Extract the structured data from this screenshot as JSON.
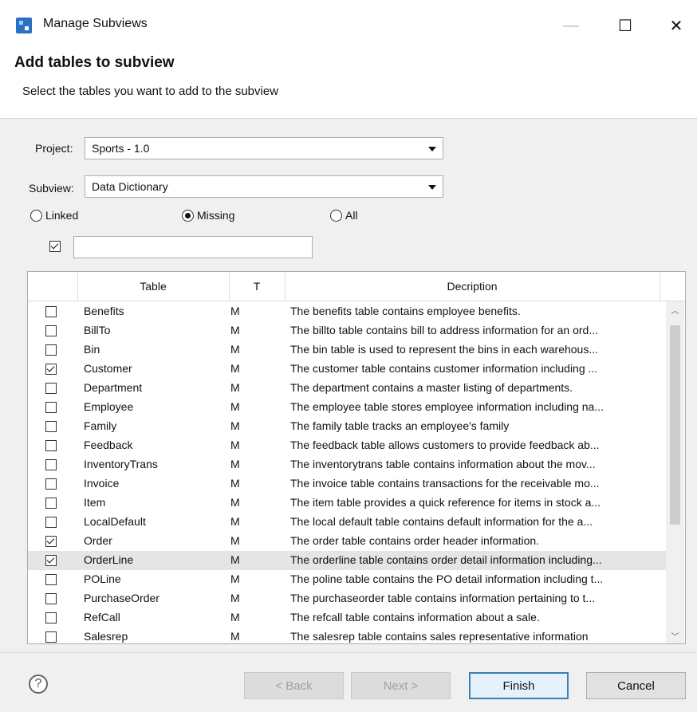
{
  "window": {
    "title": "Manage Subviews"
  },
  "header": {
    "title": "Add tables to subview",
    "subtitle": "Select the tables you want to add to the subview"
  },
  "form": {
    "project_label": "Project:",
    "project_value": "Sports - 1.0",
    "subview_label": "Subview:",
    "subview_value": "Data Dictionary",
    "radios": [
      {
        "label": "Linked",
        "selected": false
      },
      {
        "label": "Missing",
        "selected": true
      },
      {
        "label": "All",
        "selected": false
      }
    ],
    "filter_checked": true,
    "filter_value": ""
  },
  "table": {
    "columns": [
      "Table",
      "T",
      "Decription"
    ],
    "rows": [
      {
        "checked": false,
        "name": "Benefits",
        "t": "M",
        "desc": "The benefits table contains employee benefits."
      },
      {
        "checked": false,
        "name": "BillTo",
        "t": "M",
        "desc": "The billto table contains bill to address information for an ord..."
      },
      {
        "checked": false,
        "name": "Bin",
        "t": "M",
        "desc": "The bin table is used to represent the bins in each warehous..."
      },
      {
        "checked": true,
        "name": "Customer",
        "t": "M",
        "desc": "The customer table contains customer  information including ..."
      },
      {
        "checked": false,
        "name": "Department",
        "t": "M",
        "desc": "The department contains a master listing of departments."
      },
      {
        "checked": false,
        "name": "Employee",
        "t": "M",
        "desc": "The employee table stores employee information including na..."
      },
      {
        "checked": false,
        "name": "Family",
        "t": "M",
        "desc": "The family table tracks an employee's family"
      },
      {
        "checked": false,
        "name": "Feedback",
        "t": "M",
        "desc": "The feedback table allows customers to provide feedback ab..."
      },
      {
        "checked": false,
        "name": "InventoryTrans",
        "t": "M",
        "desc": "The inventorytrans table contains information about the mov..."
      },
      {
        "checked": false,
        "name": "Invoice",
        "t": "M",
        "desc": "The invoice table contains transactions for the receivable mo..."
      },
      {
        "checked": false,
        "name": "Item",
        "t": "M",
        "desc": "The item table provides a quick reference for items in stock a..."
      },
      {
        "checked": false,
        "name": "LocalDefault",
        "t": "M",
        "desc": "The local default table contains default information for the a..."
      },
      {
        "checked": true,
        "name": "Order",
        "t": "M",
        "desc": "The order table contains order header information."
      },
      {
        "checked": true,
        "name": "OrderLine",
        "t": "M",
        "desc": "The orderline table contains order detail information including...",
        "selected": true
      },
      {
        "checked": false,
        "name": "POLine",
        "t": "M",
        "desc": "The poline table contains the PO detail information including t..."
      },
      {
        "checked": false,
        "name": "PurchaseOrder",
        "t": "M",
        "desc": "The purchaseorder table contains information pertaining to t..."
      },
      {
        "checked": false,
        "name": "RefCall",
        "t": "M",
        "desc": "The refcall table contains information about a sale."
      },
      {
        "checked": false,
        "name": "Salesrep",
        "t": "M",
        "desc": "The salesrep table contains sales representative information"
      }
    ]
  },
  "footer": {
    "back_label": "< Back",
    "next_label": "Next >",
    "finish_label": "Finish",
    "cancel_label": "Cancel",
    "help_glyph": "?"
  }
}
